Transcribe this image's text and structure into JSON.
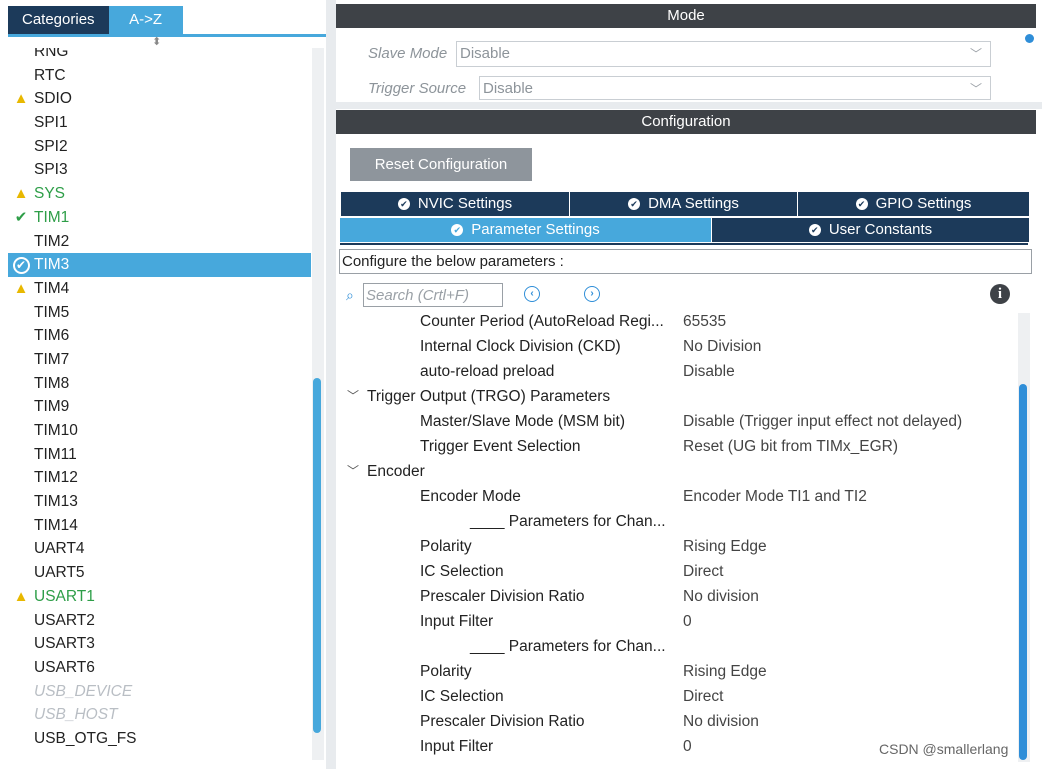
{
  "left_panel": {
    "tabs": [
      "Categories",
      "A->Z"
    ],
    "sort_arrows": "⬍",
    "items": [
      {
        "label": "RNG",
        "status": "none"
      },
      {
        "label": "RTC",
        "status": "none"
      },
      {
        "label": "SDIO",
        "status": "warning"
      },
      {
        "label": "SPI1",
        "status": "none"
      },
      {
        "label": "SPI2",
        "status": "none"
      },
      {
        "label": "SPI3",
        "status": "none"
      },
      {
        "label": "SYS",
        "status": "warning-green"
      },
      {
        "label": "TIM1",
        "status": "ok"
      },
      {
        "label": "TIM2",
        "status": "none"
      },
      {
        "label": "TIM3",
        "status": "selected"
      },
      {
        "label": "TIM4",
        "status": "warning"
      },
      {
        "label": "TIM5",
        "status": "none"
      },
      {
        "label": "TIM6",
        "status": "none"
      },
      {
        "label": "TIM7",
        "status": "none"
      },
      {
        "label": "TIM8",
        "status": "none"
      },
      {
        "label": "TIM9",
        "status": "none"
      },
      {
        "label": "TIM10",
        "status": "none"
      },
      {
        "label": "TIM11",
        "status": "none"
      },
      {
        "label": "TIM12",
        "status": "none"
      },
      {
        "label": "TIM13",
        "status": "none"
      },
      {
        "label": "TIM14",
        "status": "none"
      },
      {
        "label": "UART4",
        "status": "none"
      },
      {
        "label": "UART5",
        "status": "none"
      },
      {
        "label": "USART1",
        "status": "warning-green"
      },
      {
        "label": "USART2",
        "status": "none"
      },
      {
        "label": "USART3",
        "status": "none"
      },
      {
        "label": "USART6",
        "status": "none"
      },
      {
        "label": "USB_DEVICE",
        "status": "disabled"
      },
      {
        "label": "USB_HOST",
        "status": "disabled"
      },
      {
        "label": "USB_OTG_FS",
        "status": "none"
      }
    ]
  },
  "mode": {
    "title": "Mode",
    "slave_mode": {
      "label": "Slave Mode",
      "value": "Disable"
    },
    "trigger_source": {
      "label": "Trigger Source",
      "value": "Disable"
    }
  },
  "configuration": {
    "title": "Configuration",
    "reset_label": "Reset Configuration",
    "tabs_row1": [
      "NVIC Settings",
      "DMA Settings",
      "GPIO Settings"
    ],
    "tabs_row2": [
      "Parameter Settings",
      "User Constants"
    ],
    "active_tab": "Parameter Settings",
    "configure_text": "Configure the below parameters :",
    "search_placeholder": "Search (Crtl+F)",
    "params": [
      {
        "kind": "param",
        "name": "Counter Period (AutoReload Regi...",
        "value": "65535"
      },
      {
        "kind": "param",
        "name": "Internal Clock Division (CKD)",
        "value": "No Division"
      },
      {
        "kind": "param",
        "name": "auto-reload preload",
        "value": "Disable"
      },
      {
        "kind": "group",
        "name": "Trigger Output (TRGO) Parameters",
        "value": ""
      },
      {
        "kind": "param",
        "name": "Master/Slave Mode (MSM bit)",
        "value": "Disable (Trigger input effect not delayed)"
      },
      {
        "kind": "param",
        "name": "Trigger Event Selection",
        "value": "Reset (UG bit from TIMx_EGR)"
      },
      {
        "kind": "group",
        "name": "Encoder",
        "value": ""
      },
      {
        "kind": "param",
        "name": "Encoder Mode",
        "value": "Encoder Mode TI1 and TI2"
      },
      {
        "kind": "sub",
        "name": "____ Parameters for Chan...",
        "value": ""
      },
      {
        "kind": "param",
        "name": "Polarity",
        "value": "Rising Edge"
      },
      {
        "kind": "param",
        "name": "IC Selection",
        "value": "Direct"
      },
      {
        "kind": "param",
        "name": "Prescaler Division Ratio",
        "value": "No division"
      },
      {
        "kind": "param",
        "name": "Input Filter",
        "value": "0"
      },
      {
        "kind": "sub",
        "name": "____ Parameters for Chan...",
        "value": ""
      },
      {
        "kind": "param",
        "name": "Polarity",
        "value": "Rising Edge"
      },
      {
        "kind": "param",
        "name": "IC Selection",
        "value": "Direct"
      },
      {
        "kind": "param",
        "name": "Prescaler Division Ratio",
        "value": "No division"
      },
      {
        "kind": "param",
        "name": "Input Filter",
        "value": "0"
      }
    ]
  },
  "watermark": "CSDN @smallerlang",
  "colors": {
    "accent": "#47a8dc",
    "dark_tab": "#1c3a5a",
    "header": "#3e4247",
    "warning": "#e8b800",
    "ok": "#2e9e48"
  }
}
